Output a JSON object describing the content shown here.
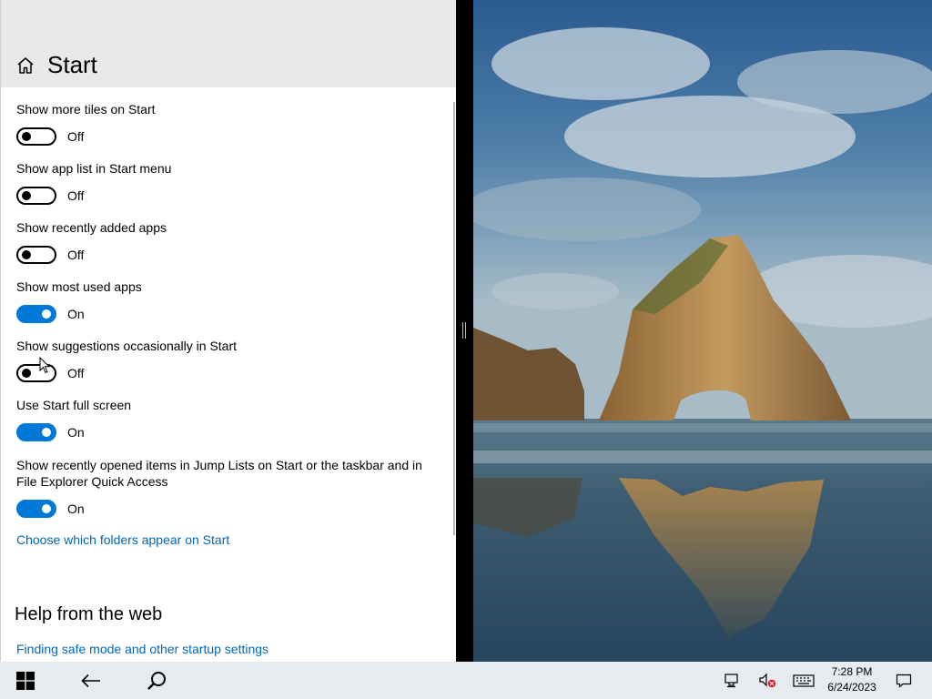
{
  "settings": {
    "title": "Start",
    "options": [
      {
        "label": "Show more tiles on Start",
        "state": "Off",
        "on": false
      },
      {
        "label": "Show app list in Start menu",
        "state": "Off",
        "on": false
      },
      {
        "label": "Show recently added apps",
        "state": "Off",
        "on": false
      },
      {
        "label": "Show most used apps",
        "state": "On",
        "on": true
      },
      {
        "label": "Show suggestions occasionally in Start",
        "state": "Off",
        "on": false
      },
      {
        "label": "Use Start full screen",
        "state": "On",
        "on": true
      },
      {
        "label": "Show recently opened items in Jump Lists on Start or the taskbar and in File Explorer Quick Access",
        "state": "On",
        "on": true
      }
    ],
    "folders_link": "Choose which folders appear on Start",
    "help_heading": "Help from the web",
    "help_link": "Finding safe mode and other startup settings"
  },
  "taskbar": {
    "icons": [
      "windows-logo-icon",
      "back-arrow-icon",
      "search-icon",
      "network-icon",
      "volume-muted-icon",
      "keyboard-icon",
      "notification-icon"
    ],
    "time": "7:28 PM",
    "date": "6/24/2023"
  },
  "colors": {
    "accent": "#0078d7",
    "link": "#0067b8",
    "header_bg": "#e8e8e8",
    "taskbar_bg": "#e7eaee"
  }
}
